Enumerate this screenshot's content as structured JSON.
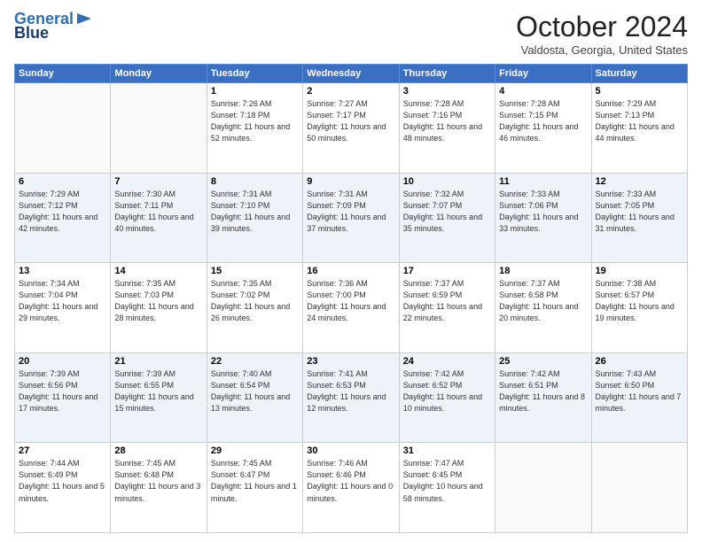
{
  "header": {
    "logo_line1": "General",
    "logo_line2": "Blue",
    "month_title": "October 2024",
    "location": "Valdosta, Georgia, United States"
  },
  "weekdays": [
    "Sunday",
    "Monday",
    "Tuesday",
    "Wednesday",
    "Thursday",
    "Friday",
    "Saturday"
  ],
  "weeks": [
    [
      {
        "day": "",
        "sunrise": "",
        "sunset": "",
        "daylight": ""
      },
      {
        "day": "",
        "sunrise": "",
        "sunset": "",
        "daylight": ""
      },
      {
        "day": "1",
        "sunrise": "Sunrise: 7:26 AM",
        "sunset": "Sunset: 7:18 PM",
        "daylight": "Daylight: 11 hours and 52 minutes."
      },
      {
        "day": "2",
        "sunrise": "Sunrise: 7:27 AM",
        "sunset": "Sunset: 7:17 PM",
        "daylight": "Daylight: 11 hours and 50 minutes."
      },
      {
        "day": "3",
        "sunrise": "Sunrise: 7:28 AM",
        "sunset": "Sunset: 7:16 PM",
        "daylight": "Daylight: 11 hours and 48 minutes."
      },
      {
        "day": "4",
        "sunrise": "Sunrise: 7:28 AM",
        "sunset": "Sunset: 7:15 PM",
        "daylight": "Daylight: 11 hours and 46 minutes."
      },
      {
        "day": "5",
        "sunrise": "Sunrise: 7:29 AM",
        "sunset": "Sunset: 7:13 PM",
        "daylight": "Daylight: 11 hours and 44 minutes."
      }
    ],
    [
      {
        "day": "6",
        "sunrise": "Sunrise: 7:29 AM",
        "sunset": "Sunset: 7:12 PM",
        "daylight": "Daylight: 11 hours and 42 minutes."
      },
      {
        "day": "7",
        "sunrise": "Sunrise: 7:30 AM",
        "sunset": "Sunset: 7:11 PM",
        "daylight": "Daylight: 11 hours and 40 minutes."
      },
      {
        "day": "8",
        "sunrise": "Sunrise: 7:31 AM",
        "sunset": "Sunset: 7:10 PM",
        "daylight": "Daylight: 11 hours and 39 minutes."
      },
      {
        "day": "9",
        "sunrise": "Sunrise: 7:31 AM",
        "sunset": "Sunset: 7:09 PM",
        "daylight": "Daylight: 11 hours and 37 minutes."
      },
      {
        "day": "10",
        "sunrise": "Sunrise: 7:32 AM",
        "sunset": "Sunset: 7:07 PM",
        "daylight": "Daylight: 11 hours and 35 minutes."
      },
      {
        "day": "11",
        "sunrise": "Sunrise: 7:33 AM",
        "sunset": "Sunset: 7:06 PM",
        "daylight": "Daylight: 11 hours and 33 minutes."
      },
      {
        "day": "12",
        "sunrise": "Sunrise: 7:33 AM",
        "sunset": "Sunset: 7:05 PM",
        "daylight": "Daylight: 11 hours and 31 minutes."
      }
    ],
    [
      {
        "day": "13",
        "sunrise": "Sunrise: 7:34 AM",
        "sunset": "Sunset: 7:04 PM",
        "daylight": "Daylight: 11 hours and 29 minutes."
      },
      {
        "day": "14",
        "sunrise": "Sunrise: 7:35 AM",
        "sunset": "Sunset: 7:03 PM",
        "daylight": "Daylight: 11 hours and 28 minutes."
      },
      {
        "day": "15",
        "sunrise": "Sunrise: 7:35 AM",
        "sunset": "Sunset: 7:02 PM",
        "daylight": "Daylight: 11 hours and 26 minutes."
      },
      {
        "day": "16",
        "sunrise": "Sunrise: 7:36 AM",
        "sunset": "Sunset: 7:00 PM",
        "daylight": "Daylight: 11 hours and 24 minutes."
      },
      {
        "day": "17",
        "sunrise": "Sunrise: 7:37 AM",
        "sunset": "Sunset: 6:59 PM",
        "daylight": "Daylight: 11 hours and 22 minutes."
      },
      {
        "day": "18",
        "sunrise": "Sunrise: 7:37 AM",
        "sunset": "Sunset: 6:58 PM",
        "daylight": "Daylight: 11 hours and 20 minutes."
      },
      {
        "day": "19",
        "sunrise": "Sunrise: 7:38 AM",
        "sunset": "Sunset: 6:57 PM",
        "daylight": "Daylight: 11 hours and 19 minutes."
      }
    ],
    [
      {
        "day": "20",
        "sunrise": "Sunrise: 7:39 AM",
        "sunset": "Sunset: 6:56 PM",
        "daylight": "Daylight: 11 hours and 17 minutes."
      },
      {
        "day": "21",
        "sunrise": "Sunrise: 7:39 AM",
        "sunset": "Sunset: 6:55 PM",
        "daylight": "Daylight: 11 hours and 15 minutes."
      },
      {
        "day": "22",
        "sunrise": "Sunrise: 7:40 AM",
        "sunset": "Sunset: 6:54 PM",
        "daylight": "Daylight: 11 hours and 13 minutes."
      },
      {
        "day": "23",
        "sunrise": "Sunrise: 7:41 AM",
        "sunset": "Sunset: 6:53 PM",
        "daylight": "Daylight: 11 hours and 12 minutes."
      },
      {
        "day": "24",
        "sunrise": "Sunrise: 7:42 AM",
        "sunset": "Sunset: 6:52 PM",
        "daylight": "Daylight: 11 hours and 10 minutes."
      },
      {
        "day": "25",
        "sunrise": "Sunrise: 7:42 AM",
        "sunset": "Sunset: 6:51 PM",
        "daylight": "Daylight: 11 hours and 8 minutes."
      },
      {
        "day": "26",
        "sunrise": "Sunrise: 7:43 AM",
        "sunset": "Sunset: 6:50 PM",
        "daylight": "Daylight: 11 hours and 7 minutes."
      }
    ],
    [
      {
        "day": "27",
        "sunrise": "Sunrise: 7:44 AM",
        "sunset": "Sunset: 6:49 PM",
        "daylight": "Daylight: 11 hours and 5 minutes."
      },
      {
        "day": "28",
        "sunrise": "Sunrise: 7:45 AM",
        "sunset": "Sunset: 6:48 PM",
        "daylight": "Daylight: 11 hours and 3 minutes."
      },
      {
        "day": "29",
        "sunrise": "Sunrise: 7:45 AM",
        "sunset": "Sunset: 6:47 PM",
        "daylight": "Daylight: 11 hours and 1 minute."
      },
      {
        "day": "30",
        "sunrise": "Sunrise: 7:46 AM",
        "sunset": "Sunset: 6:46 PM",
        "daylight": "Daylight: 11 hours and 0 minutes."
      },
      {
        "day": "31",
        "sunrise": "Sunrise: 7:47 AM",
        "sunset": "Sunset: 6:45 PM",
        "daylight": "Daylight: 10 hours and 58 minutes."
      },
      {
        "day": "",
        "sunrise": "",
        "sunset": "",
        "daylight": ""
      },
      {
        "day": "",
        "sunrise": "",
        "sunset": "",
        "daylight": ""
      }
    ]
  ]
}
